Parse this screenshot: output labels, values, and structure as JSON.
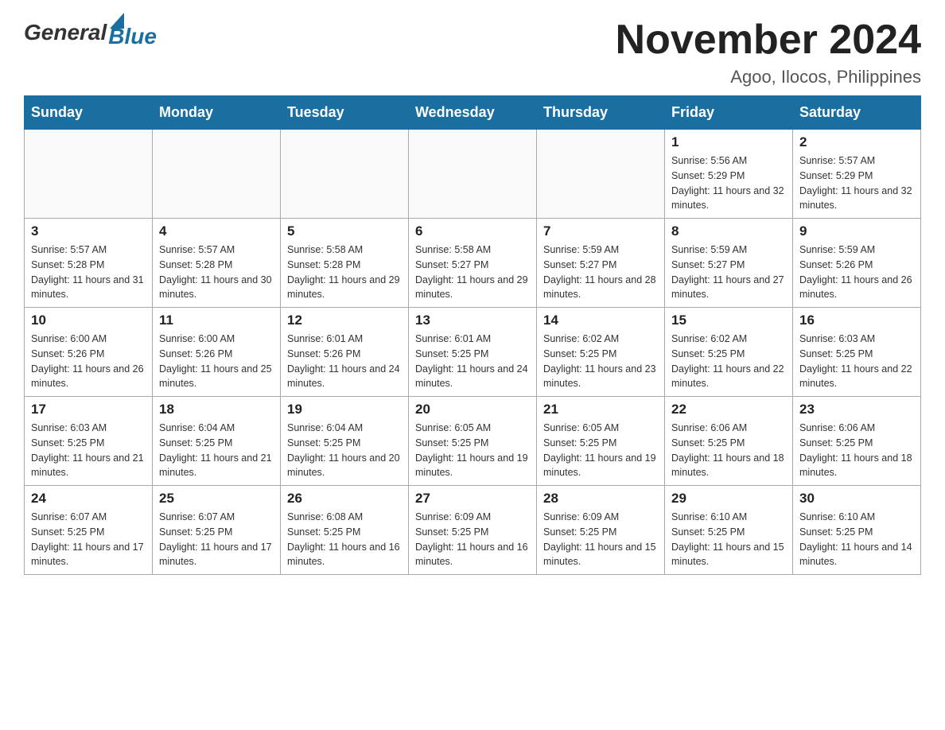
{
  "header": {
    "logo_general": "General",
    "logo_blue": "Blue",
    "month_title": "November 2024",
    "location": "Agoo, Ilocos, Philippines"
  },
  "days_of_week": [
    "Sunday",
    "Monday",
    "Tuesday",
    "Wednesday",
    "Thursday",
    "Friday",
    "Saturday"
  ],
  "weeks": [
    [
      {
        "day": "",
        "info": ""
      },
      {
        "day": "",
        "info": ""
      },
      {
        "day": "",
        "info": ""
      },
      {
        "day": "",
        "info": ""
      },
      {
        "day": "",
        "info": ""
      },
      {
        "day": "1",
        "info": "Sunrise: 5:56 AM\nSunset: 5:29 PM\nDaylight: 11 hours and 32 minutes."
      },
      {
        "day": "2",
        "info": "Sunrise: 5:57 AM\nSunset: 5:29 PM\nDaylight: 11 hours and 32 minutes."
      }
    ],
    [
      {
        "day": "3",
        "info": "Sunrise: 5:57 AM\nSunset: 5:28 PM\nDaylight: 11 hours and 31 minutes."
      },
      {
        "day": "4",
        "info": "Sunrise: 5:57 AM\nSunset: 5:28 PM\nDaylight: 11 hours and 30 minutes."
      },
      {
        "day": "5",
        "info": "Sunrise: 5:58 AM\nSunset: 5:28 PM\nDaylight: 11 hours and 29 minutes."
      },
      {
        "day": "6",
        "info": "Sunrise: 5:58 AM\nSunset: 5:27 PM\nDaylight: 11 hours and 29 minutes."
      },
      {
        "day": "7",
        "info": "Sunrise: 5:59 AM\nSunset: 5:27 PM\nDaylight: 11 hours and 28 minutes."
      },
      {
        "day": "8",
        "info": "Sunrise: 5:59 AM\nSunset: 5:27 PM\nDaylight: 11 hours and 27 minutes."
      },
      {
        "day": "9",
        "info": "Sunrise: 5:59 AM\nSunset: 5:26 PM\nDaylight: 11 hours and 26 minutes."
      }
    ],
    [
      {
        "day": "10",
        "info": "Sunrise: 6:00 AM\nSunset: 5:26 PM\nDaylight: 11 hours and 26 minutes."
      },
      {
        "day": "11",
        "info": "Sunrise: 6:00 AM\nSunset: 5:26 PM\nDaylight: 11 hours and 25 minutes."
      },
      {
        "day": "12",
        "info": "Sunrise: 6:01 AM\nSunset: 5:26 PM\nDaylight: 11 hours and 24 minutes."
      },
      {
        "day": "13",
        "info": "Sunrise: 6:01 AM\nSunset: 5:25 PM\nDaylight: 11 hours and 24 minutes."
      },
      {
        "day": "14",
        "info": "Sunrise: 6:02 AM\nSunset: 5:25 PM\nDaylight: 11 hours and 23 minutes."
      },
      {
        "day": "15",
        "info": "Sunrise: 6:02 AM\nSunset: 5:25 PM\nDaylight: 11 hours and 22 minutes."
      },
      {
        "day": "16",
        "info": "Sunrise: 6:03 AM\nSunset: 5:25 PM\nDaylight: 11 hours and 22 minutes."
      }
    ],
    [
      {
        "day": "17",
        "info": "Sunrise: 6:03 AM\nSunset: 5:25 PM\nDaylight: 11 hours and 21 minutes."
      },
      {
        "day": "18",
        "info": "Sunrise: 6:04 AM\nSunset: 5:25 PM\nDaylight: 11 hours and 21 minutes."
      },
      {
        "day": "19",
        "info": "Sunrise: 6:04 AM\nSunset: 5:25 PM\nDaylight: 11 hours and 20 minutes."
      },
      {
        "day": "20",
        "info": "Sunrise: 6:05 AM\nSunset: 5:25 PM\nDaylight: 11 hours and 19 minutes."
      },
      {
        "day": "21",
        "info": "Sunrise: 6:05 AM\nSunset: 5:25 PM\nDaylight: 11 hours and 19 minutes."
      },
      {
        "day": "22",
        "info": "Sunrise: 6:06 AM\nSunset: 5:25 PM\nDaylight: 11 hours and 18 minutes."
      },
      {
        "day": "23",
        "info": "Sunrise: 6:06 AM\nSunset: 5:25 PM\nDaylight: 11 hours and 18 minutes."
      }
    ],
    [
      {
        "day": "24",
        "info": "Sunrise: 6:07 AM\nSunset: 5:25 PM\nDaylight: 11 hours and 17 minutes."
      },
      {
        "day": "25",
        "info": "Sunrise: 6:07 AM\nSunset: 5:25 PM\nDaylight: 11 hours and 17 minutes."
      },
      {
        "day": "26",
        "info": "Sunrise: 6:08 AM\nSunset: 5:25 PM\nDaylight: 11 hours and 16 minutes."
      },
      {
        "day": "27",
        "info": "Sunrise: 6:09 AM\nSunset: 5:25 PM\nDaylight: 11 hours and 16 minutes."
      },
      {
        "day": "28",
        "info": "Sunrise: 6:09 AM\nSunset: 5:25 PM\nDaylight: 11 hours and 15 minutes."
      },
      {
        "day": "29",
        "info": "Sunrise: 6:10 AM\nSunset: 5:25 PM\nDaylight: 11 hours and 15 minutes."
      },
      {
        "day": "30",
        "info": "Sunrise: 6:10 AM\nSunset: 5:25 PM\nDaylight: 11 hours and 14 minutes."
      }
    ]
  ]
}
